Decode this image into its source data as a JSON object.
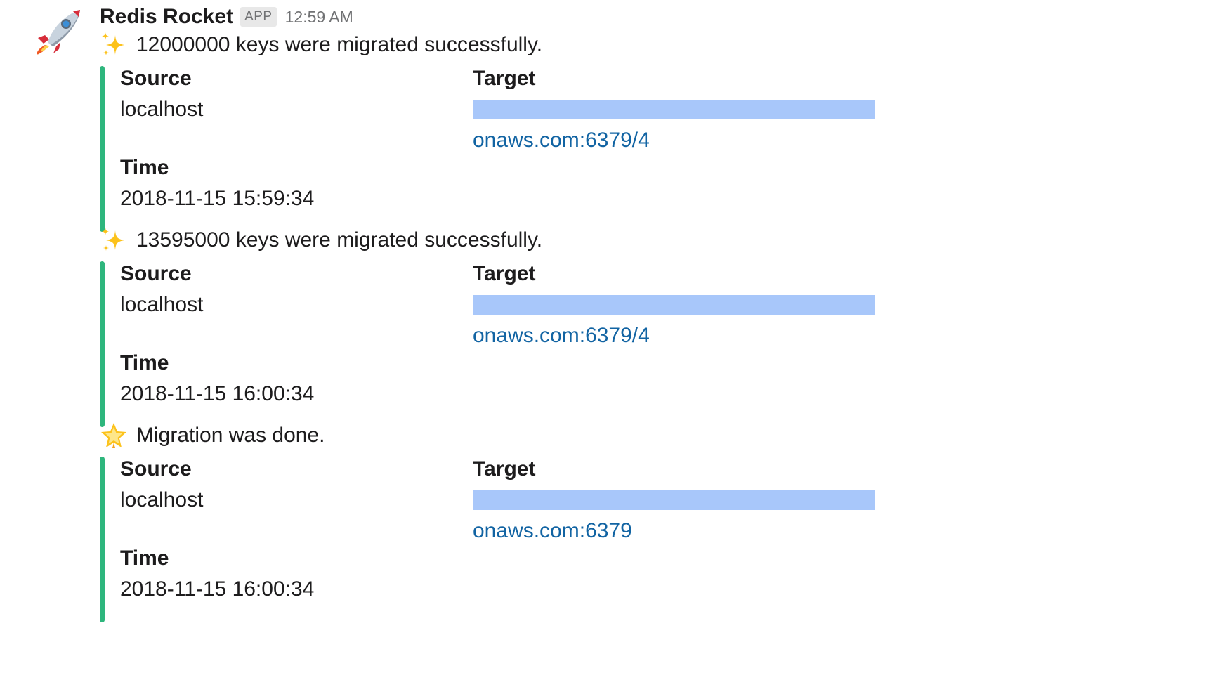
{
  "header": {
    "sender": "Redis Rocket",
    "badge": "APP",
    "time": "12:59 AM",
    "avatar_icon": "rocket-icon"
  },
  "colors": {
    "attachment_bar": "#2eb67d",
    "link": "#1264a3",
    "redaction": "#a8c7fa"
  },
  "messages": [
    {
      "emoji": "sparkles-icon",
      "text": "12000000 keys were migrated successfully.",
      "fields": {
        "source_title": "Source",
        "source_value": "localhost",
        "target_title": "Target",
        "target_link": "onaws.com:6379/4",
        "time_title": "Time",
        "time_value": "2018-11-15 15:59:34"
      }
    },
    {
      "emoji": "sparkles-icon",
      "text": "13595000 keys were migrated successfully.",
      "fields": {
        "source_title": "Source",
        "source_value": "localhost",
        "target_title": "Target",
        "target_link": "onaws.com:6379/4",
        "time_title": "Time",
        "time_value": "2018-11-15 16:00:34"
      }
    },
    {
      "emoji": "glowing-star-icon",
      "text": "Migration was done.",
      "fields": {
        "source_title": "Source",
        "source_value": "localhost",
        "target_title": "Target",
        "target_link": "onaws.com:6379",
        "time_title": "Time",
        "time_value": "2018-11-15 16:00:34"
      }
    }
  ]
}
